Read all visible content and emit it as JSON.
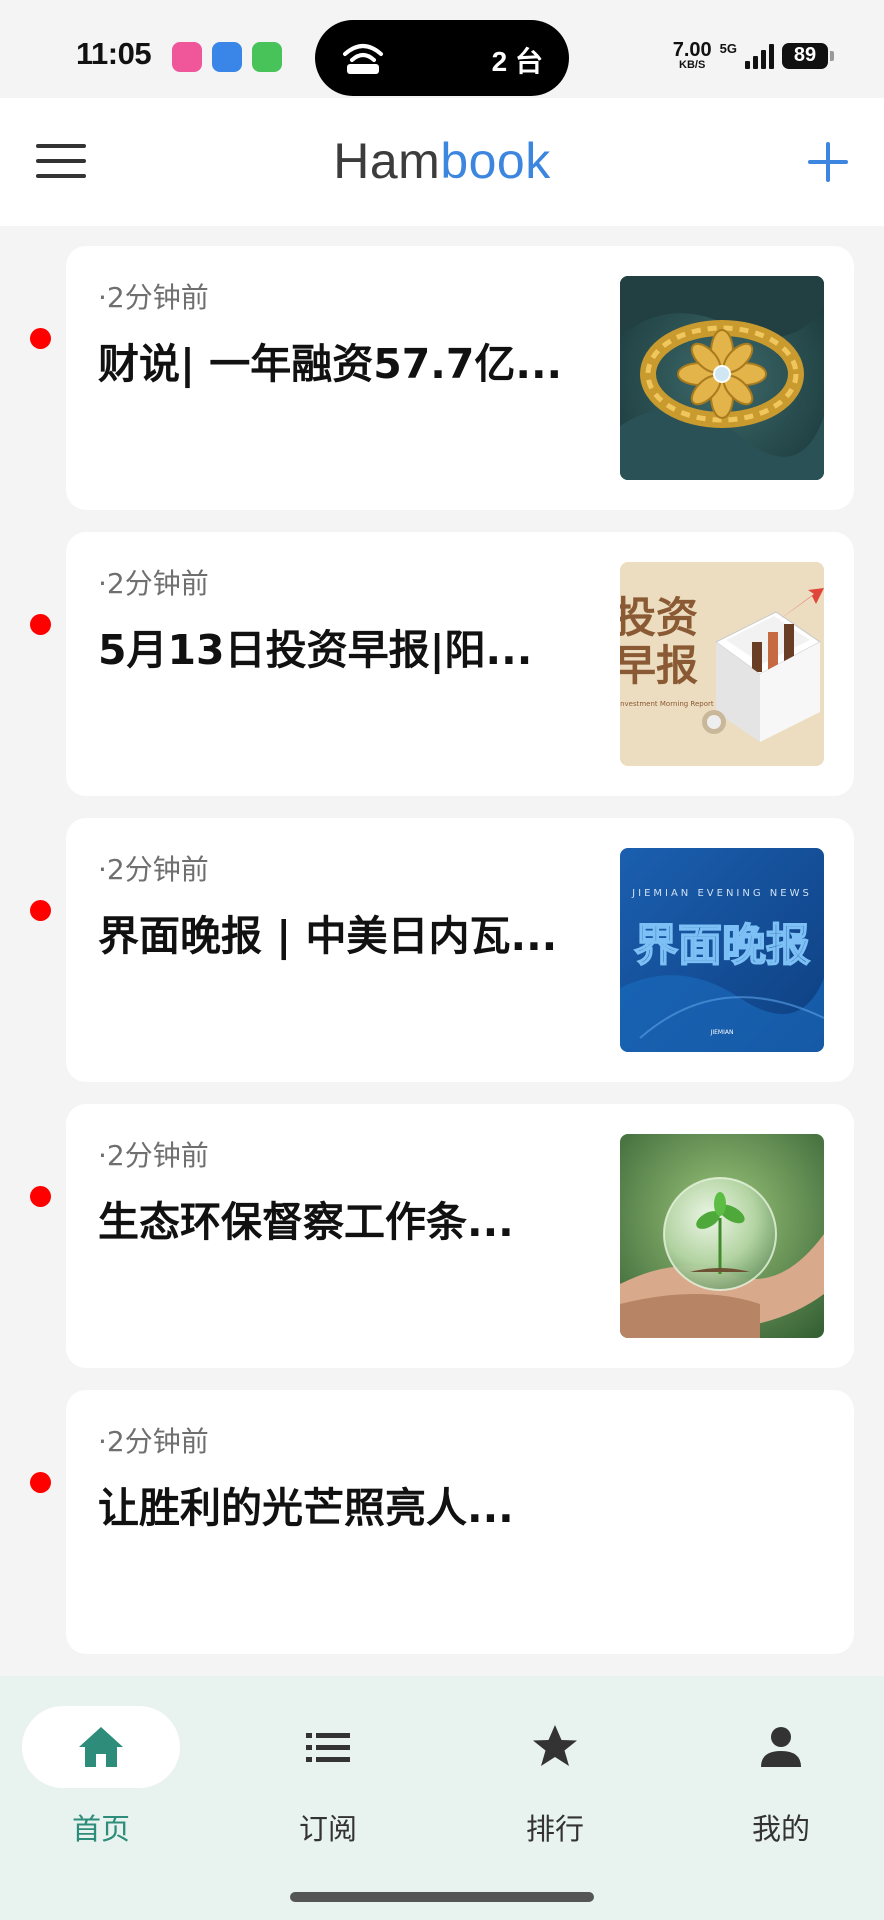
{
  "status_bar": {
    "time": "11:05",
    "island_text": "2 台",
    "net_speed_value": "7.00",
    "net_speed_unit": "KB/S",
    "network_type": "5G",
    "battery": "89",
    "app_icon_colors": [
      "#f0569a",
      "#3a86e8",
      "#48c35a"
    ]
  },
  "header": {
    "brand_part1": "Ham",
    "brand_part2": "book",
    "brand_colors": [
      "#3c3c3c",
      "#3d86df"
    ],
    "menu_icon": "hamburger-menu-icon",
    "add_icon": "plus-icon"
  },
  "feed": {
    "items": [
      {
        "time": "·2分钟前",
        "title": "财说| 一年融资57.7亿...",
        "unread": true,
        "thumbnail": "gold-flower-ring"
      },
      {
        "time": "·2分钟前",
        "title": "5月13日投资早报|阳...",
        "unread": true,
        "thumbnail": "investment-morning-report",
        "thumb_text": "投资早报",
        "thumb_subtext": "Investment Morning Report"
      },
      {
        "time": "·2分钟前",
        "title": "界面晚报 | 中美日内瓦...",
        "unread": true,
        "thumbnail": "jiemian-evening-news",
        "thumb_text": "界面晚报",
        "thumb_subtext": "JIEMIAN EVENING NEWS"
      },
      {
        "time": "·2分钟前",
        "title": "生态环保督察工作条...",
        "unread": true,
        "thumbnail": "glass-globe-plant"
      },
      {
        "time": "·2分钟前",
        "title": "让胜利的光芒照亮人...",
        "unread": true,
        "thumbnail": null
      }
    ]
  },
  "bottom_nav": {
    "active_color": "#2d8c7a",
    "items": [
      {
        "label": "首页",
        "icon": "home-icon",
        "active": true
      },
      {
        "label": "订阅",
        "icon": "list-icon",
        "active": false
      },
      {
        "label": "排行",
        "icon": "star-icon",
        "active": false
      },
      {
        "label": "我的",
        "icon": "person-icon",
        "active": false
      }
    ]
  }
}
